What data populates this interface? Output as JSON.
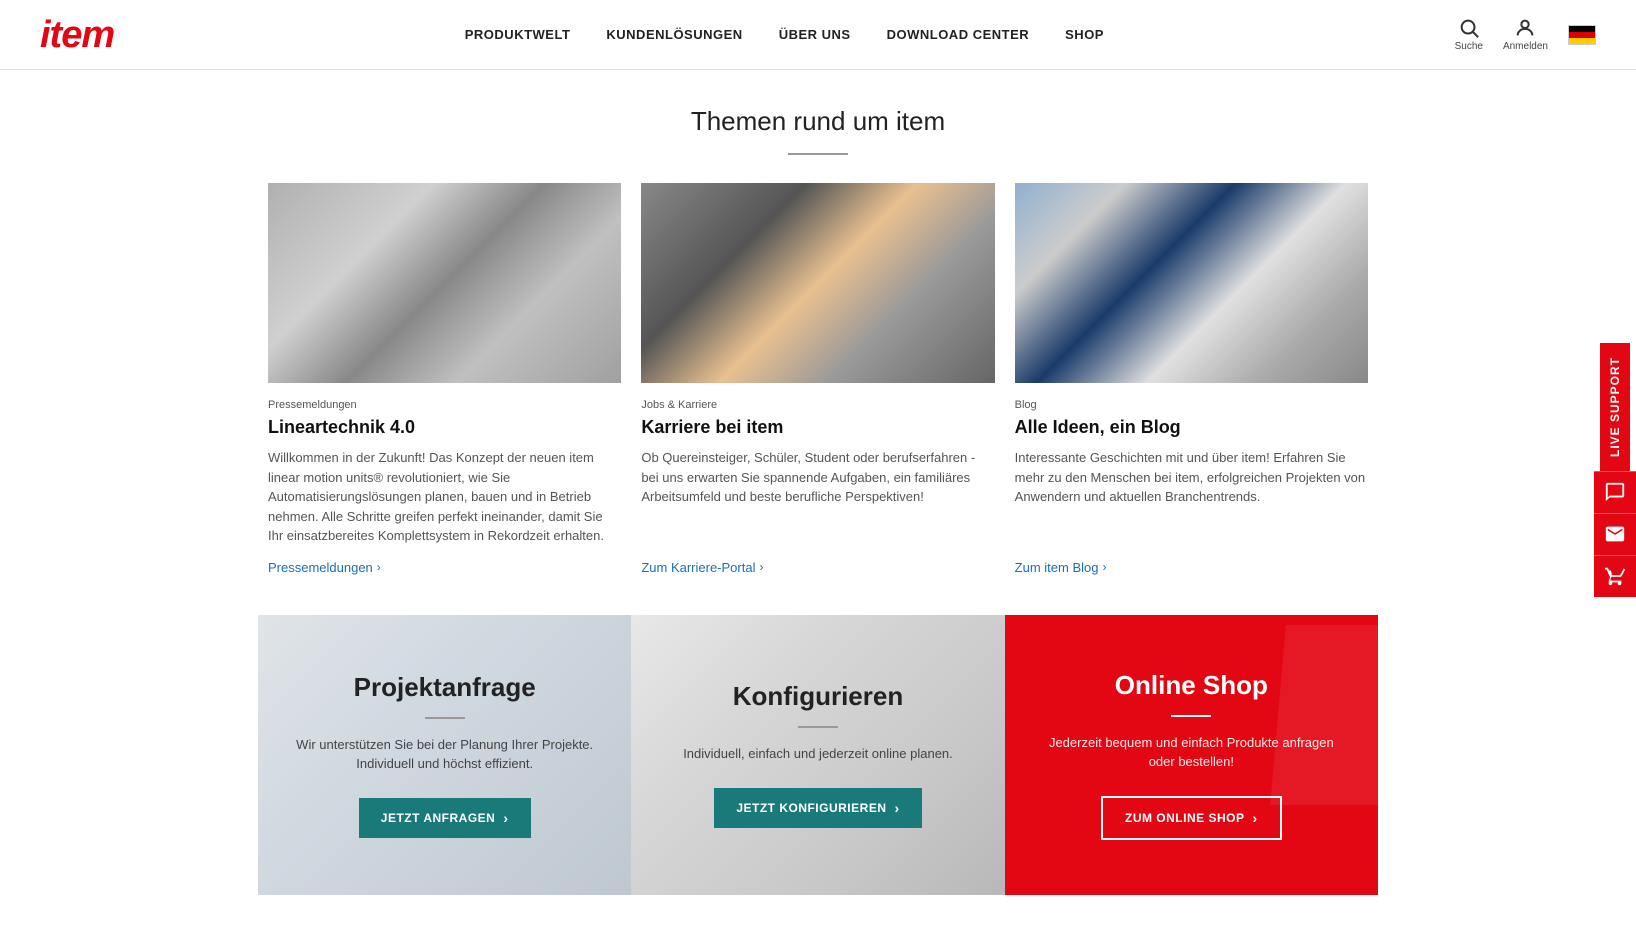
{
  "header": {
    "logo": "item",
    "nav": [
      {
        "id": "produktwelt",
        "label": "PRODUKTWELT"
      },
      {
        "id": "kundenlösungen",
        "label": "KUNDENLÖSUNGEN"
      },
      {
        "id": "uber-uns",
        "label": "ÜBER UNS"
      },
      {
        "id": "download-center",
        "label": "DOWNLOAD CENTER"
      },
      {
        "id": "shop",
        "label": "SHOP"
      }
    ],
    "search_label": "Suche",
    "login_label": "Anmelden",
    "language": "DE"
  },
  "page_title": "Themen rund um item",
  "top_cards": [
    {
      "category": "Pressemeldungen",
      "title": "Lineartechnik 4.0",
      "desc": "Willkommen in der Zukunft! Das Konzept der neuen item linear motion units® revolutioniert, wie Sie Automatisierungslösungen planen, bauen und in Betrieb nehmen. Alle Schritte greifen perfekt ineinander, damit Sie Ihr einsatzbereites Komplettsystem in Rekordzeit erhalten.",
      "link_label": "Pressemeldungen",
      "img_class": "img-machinery"
    },
    {
      "category": "Jobs & Karriere",
      "title": "Karriere bei item",
      "desc": "Ob Quereinsteiger, Schüler, Student oder berufserfahren - bei uns erwarten Sie spannende Aufgaben, ein familiäres Arbeitsumfeld und beste berufliche Perspektiven!",
      "link_label": "Zum Karriere-Portal",
      "img_class": "img-people"
    },
    {
      "category": "Blog",
      "title": "Alle Ideen, ein Blog",
      "desc": "Interessante Geschichten mit und über item! Erfahren Sie mehr zu den Menschen bei item, erfolgreichen Projekten von Anwendern und aktuellen Branchentrends.",
      "link_label": "Zum item Blog",
      "img_class": "img-screen"
    }
  ],
  "banner_cards": [
    {
      "id": "projektanfrage",
      "title": "Projektanfrage",
      "desc": "Wir unterstützen Sie bei der Planung Ihrer Projekte. Individuell und höchst effizient.",
      "btn_label": "JETZT ANFRAGEN",
      "bg": "light",
      "btn_type": "teal"
    },
    {
      "id": "konfigurieren",
      "title": "Konfigurieren",
      "desc": "Individuell, einfach und jederzeit online planen.",
      "btn_label": "JETZT KONFIGURIEREN",
      "bg": "laptop",
      "btn_type": "teal"
    },
    {
      "id": "online-shop",
      "title": "Online Shop",
      "desc": "Jederzeit bequem und einfach Produkte anfragen oder bestellen!",
      "btn_label": "ZUM ONLINE SHOP",
      "bg": "red",
      "btn_type": "outline-white"
    }
  ],
  "live_support": {
    "tab_label": "LIVE SUPPORT",
    "chat_icon": "💬",
    "mail_icon": "✉",
    "cart_icon": "🛒"
  }
}
